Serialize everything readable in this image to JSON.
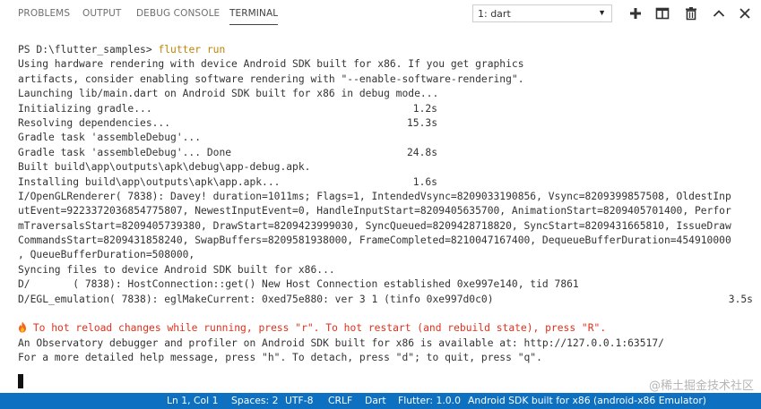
{
  "panel_tabs": [
    {
      "label": "PROBLEMS",
      "active": false
    },
    {
      "label": "OUTPUT",
      "active": false
    },
    {
      "label": "DEBUG CONSOLE",
      "active": false
    },
    {
      "label": "TERMINAL",
      "active": true
    }
  ],
  "terminal_selector": {
    "value": "1: dart"
  },
  "toolbar_icons": [
    "plus-icon",
    "split-terminal-icon",
    "trash-icon",
    "chevron-up-icon",
    "close-icon"
  ],
  "terminal": {
    "prompt": "PS D:\\flutter_samples> ",
    "command": "flutter run",
    "lines": [
      {
        "text": "Using hardware rendering with device Android SDK built for x86. If you get graphics"
      },
      {
        "text": "artifacts, consider enabling software rendering with \"--enable-software-rendering\"."
      },
      {
        "text": "Launching lib/main.dart on Android SDK built for x86 in debug mode..."
      },
      {
        "text": "Initializing gradle...",
        "right": "1.2s"
      },
      {
        "text": "Resolving dependencies...",
        "right": "15.3s"
      },
      {
        "text": "Gradle task 'assembleDebug'..."
      },
      {
        "text": "Gradle task 'assembleDebug'... Done",
        "right": "24.8s"
      },
      {
        "text": "Built build\\app\\outputs\\apk\\debug\\app-debug.apk."
      },
      {
        "text": "Installing build\\app\\outputs\\apk\\app.apk...",
        "right": "1.6s"
      },
      {
        "text": "I/OpenGLRenderer( 7838): Davey! duration=1011ms; Flags=1, IntendedVsync=8209033190856, Vsync=8209399857508, OldestInp"
      },
      {
        "text": "utEvent=9223372036854775807, NewestInputEvent=0, HandleInputStart=8209405635700, AnimationStart=8209405701400, Perfor"
      },
      {
        "text": "mTraversalsStart=8209405739380, DrawStart=8209423999030, SyncQueued=8209428718820, SyncStart=8209431665810, IssueDraw"
      },
      {
        "text": "CommandsStart=8209431858240, SwapBuffers=8209581938000, FrameCompleted=8210047167400, DequeueBufferDuration=454910000"
      },
      {
        "text": ", QueueBufferDuration=508000,"
      },
      {
        "text": "Syncing files to device Android SDK built for x86..."
      },
      {
        "text": "D/       ( 7838): HostConnection::get() New Host Connection established 0xe997e140, tid 7861"
      },
      {
        "text": "D/EGL_emulation( 7838): eglMakeCurrent: 0xed75e880: ver 3 1 (tinfo 0xe997d0c0)",
        "right": "3.5s"
      },
      {
        "text": ""
      },
      {
        "text": "To hot reload changes while running, press \"r\". To hot restart (and rebuild state), press \"R\".",
        "style": "warn",
        "icon": "fire-icon"
      },
      {
        "text": "An Observatory debugger and profiler on Android SDK built for x86 is available at: http://127.0.0.1:63517/"
      },
      {
        "text": "For a more detailed help message, press \"h\". To detach, press \"d\"; to quit, press \"q\"."
      }
    ]
  },
  "status_bar": {
    "position": "Ln 1, Col 1",
    "spaces": "Spaces: 2",
    "encoding": "UTF-8",
    "eol": "CRLF",
    "language": "Dart",
    "flutter_version": "Flutter: 1.0.0",
    "device": "Android SDK built for x86 (android-x86 Emulator)"
  },
  "watermark": "@稀土掘金技术社区"
}
